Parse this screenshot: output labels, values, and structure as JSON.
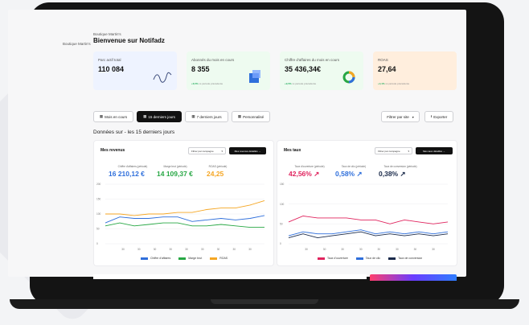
{
  "header": {
    "breadcrumb": "Boutique Martin's",
    "title": "Bienvenue sur Notifadz"
  },
  "kpis": [
    {
      "label": "Parc actif total",
      "value": "110 084",
      "note": "",
      "note_pct": "",
      "color": "#eef3ff"
    },
    {
      "label": "Abonnés du mois en cours",
      "value": "8 355",
      "note_pct": "+6,5%",
      "note": " vs période précédente",
      "color": "#eefbf0"
    },
    {
      "label": "Chiffre d'affaires du mois en cours",
      "value": "35 436,34€",
      "note_pct": "+9,5%",
      "note": " vs période précédente",
      "color": "#eefbf0"
    },
    {
      "label": "ROAS",
      "value": "27,64",
      "note_pct": "+4,1%",
      "note": " vs période précédente",
      "color": "#fff0e0"
    }
  ],
  "filters": {
    "mois": "Mois en cours",
    "quinze": "15 derniers jours",
    "sept": "7 derniers jours",
    "perso": "Personnalisé",
    "site": "Filtrer par site",
    "export": "Exporter"
  },
  "section_label": "Données sur - les 15 derniers jours",
  "left_panel": {
    "title": "Mes revenus",
    "select": "Filtrer par campagne",
    "details": "Mes revenus détaillés →",
    "kpis": [
      {
        "label": "Chiffre d'affaires (période)",
        "value": "16 210,12 €",
        "color": "#2f6fdb"
      },
      {
        "label": "Marge brut (période)",
        "value": "14 109,37 €",
        "color": "#27a744"
      },
      {
        "label": "ROAS (période)",
        "value": "24,25",
        "color": "#f5a623"
      }
    ],
    "legend": [
      "Chiffre d'affaires",
      "Marge brut",
      "ROAS"
    ]
  },
  "right_panel": {
    "title": "Mes taux",
    "select": "Filtrer par campagne",
    "details": "Mes taux détaillés →",
    "kpis": [
      {
        "label": "Taux d'ouverture (période)",
        "value": "42,56% ↗",
        "color": "#e0245e"
      },
      {
        "label": "Taux de clic (période)",
        "value": "0,58% ↗",
        "color": "#2f6fdb"
      },
      {
        "label": "Taux de conversion (période)",
        "value": "0,38% ↗",
        "color": "#1a2a4a"
      }
    ],
    "legend": [
      "Taux d'ouverture",
      "Taux de clic",
      "Taux de conversion"
    ]
  },
  "chart_data": [
    {
      "type": "line",
      "title": "Mes revenus",
      "y_ticks": [
        "200",
        "150",
        "100",
        "50",
        "0"
      ],
      "ylim": [
        0,
        200
      ],
      "x": [
        "1",
        "2",
        "3",
        "4",
        "5",
        "6",
        "7",
        "8",
        "9",
        "10",
        "11",
        "12"
      ],
      "x_tick_labels": [
        "30",
        "30",
        "30",
        "30",
        "30",
        "30",
        "30",
        "30",
        "30"
      ],
      "series": [
        {
          "name": "Chiffre d'affaires",
          "color": "#2f6fdb",
          "values": [
            70,
            90,
            85,
            85,
            90,
            90,
            75,
            80,
            85,
            80,
            85,
            95
          ]
        },
        {
          "name": "Marge brut",
          "color": "#27a744",
          "values": [
            60,
            70,
            60,
            65,
            70,
            70,
            60,
            60,
            65,
            60,
            55,
            55
          ]
        },
        {
          "name": "ROAS",
          "color": "#f5a623",
          "values": [
            100,
            100,
            95,
            100,
            100,
            105,
            105,
            115,
            120,
            120,
            130,
            145
          ]
        }
      ]
    },
    {
      "type": "line",
      "title": "Mes taux",
      "y_ticks": [
        "150",
        "100",
        "50",
        "0"
      ],
      "ylim": [
        0,
        150
      ],
      "x": [
        "1",
        "2",
        "3",
        "4",
        "5",
        "6",
        "7",
        "8",
        "9",
        "10",
        "11",
        "12"
      ],
      "x_tick_labels": [
        "30",
        "30",
        "30",
        "30",
        "30",
        "30",
        "30",
        "30"
      ],
      "series": [
        {
          "name": "Taux d'ouverture",
          "color": "#e0245e",
          "values": [
            55,
            70,
            65,
            65,
            65,
            60,
            60,
            50,
            60,
            55,
            50,
            55
          ]
        },
        {
          "name": "Taux de clic",
          "color": "#2f6fdb",
          "values": [
            20,
            30,
            25,
            25,
            30,
            35,
            25,
            30,
            25,
            30,
            25,
            30
          ]
        },
        {
          "name": "Taux de conversion",
          "color": "#1a2a4a",
          "values": [
            15,
            25,
            15,
            20,
            25,
            30,
            20,
            25,
            20,
            25,
            20,
            25
          ]
        }
      ]
    }
  ]
}
